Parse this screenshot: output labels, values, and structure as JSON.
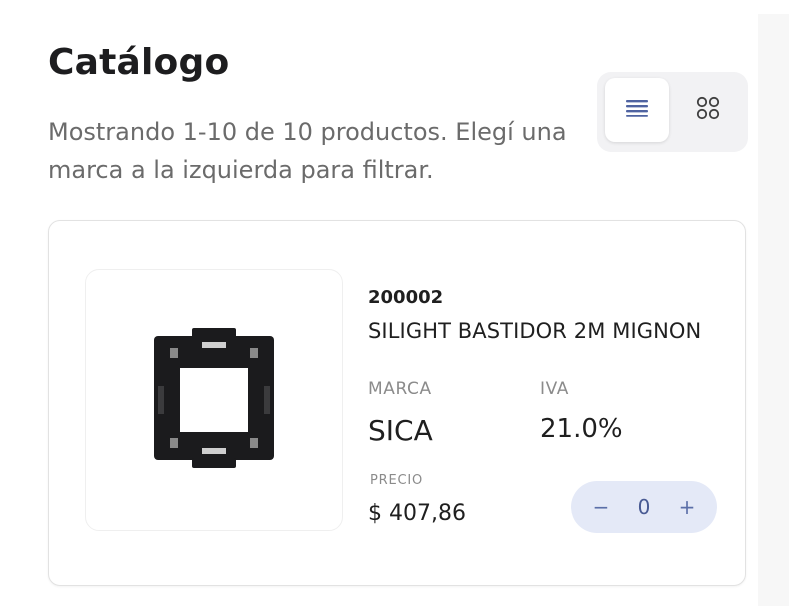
{
  "catalog": {
    "title": "Catálogo",
    "subtitle": "Mostrando 1-10 de 10 productos. Elegí una marca a la izquierda para filtrar."
  },
  "view_toggle": {
    "active": "list",
    "list_icon": "list-view-icon",
    "grid_icon": "grid-view-icon"
  },
  "products": [
    {
      "code": "200002",
      "name": "SILIGHT BASTIDOR 2M MIGNON",
      "marca_label": "MARCA",
      "marca": "SICA",
      "iva_label": "IVA",
      "iva": "21.0%",
      "precio_label": "PRECIO",
      "precio": "$ 407,86",
      "quantity": {
        "minus": "−",
        "value": "0",
        "plus": "+"
      }
    }
  ],
  "colors": {
    "accent": "#5b6fa8",
    "qty_bg": "#e4e9f7",
    "text": "#1f1f1f",
    "muted": "#8b8b8b"
  }
}
